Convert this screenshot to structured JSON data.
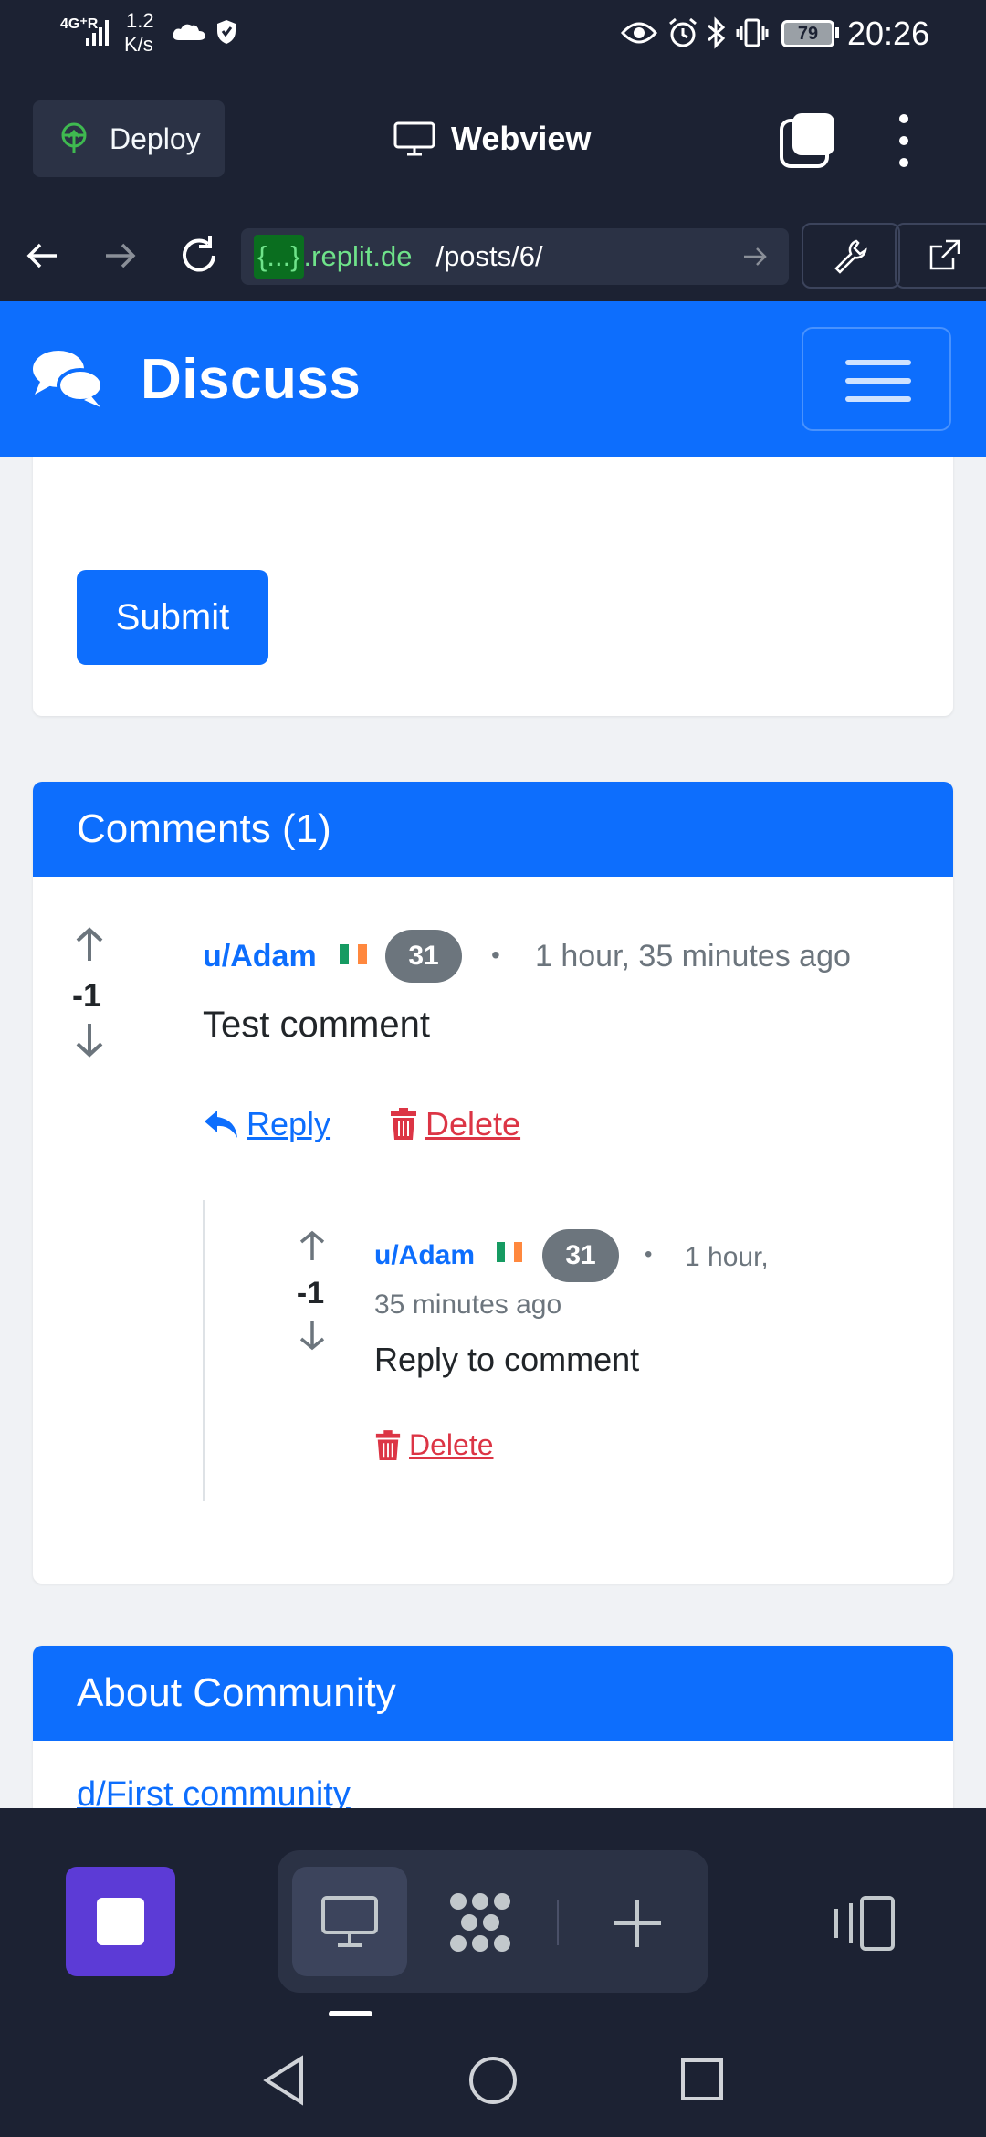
{
  "status_bar": {
    "network": "4G⁺R",
    "speed": "1.2",
    "speed_unit": "K/s",
    "battery": "79",
    "time": "20:26"
  },
  "replit_bar": {
    "deploy_label": "Deploy",
    "webview_label": "Webview"
  },
  "url_bar": {
    "domain_prefix": "{...}",
    "domain": ".replit.de",
    "path": "/posts/6/"
  },
  "site": {
    "brand": "Discuss",
    "submit_label": "Submit"
  },
  "comments": {
    "header": "Comments (1)",
    "top": {
      "score": "-1",
      "user": "u/Adam",
      "karma": "31",
      "separator": "•",
      "time": "1 hour, 35 minutes ago",
      "body": "Test comment",
      "reply_label": " Reply ",
      "delete_label": " Delete"
    },
    "reply": {
      "score": "-1",
      "user": "u/Adam",
      "karma": "31",
      "separator": "•",
      "time_line1": "1 hour,",
      "time_line2": "35 minutes ago",
      "body": "Reply to comment",
      "delete_label": " Delete"
    }
  },
  "about": {
    "header": "About Community",
    "community_link": "d/First community"
  },
  "colors": {
    "primary": "#0d6efd",
    "danger": "#dc3545",
    "badge": "#6c757d",
    "replit_bg": "#1c2233",
    "stop_button": "#5c3bd6"
  }
}
